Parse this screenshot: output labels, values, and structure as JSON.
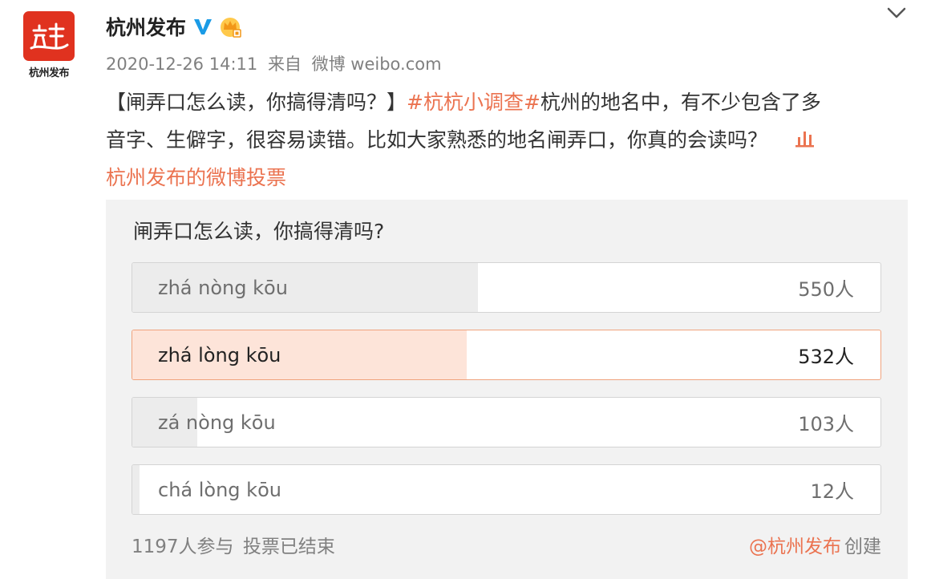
{
  "user": {
    "name": "杭州发布",
    "avatar_label": "杭州发布"
  },
  "meta": {
    "timestamp": "2020-12-26 14:11",
    "source_prefix": "来自",
    "source": "微博 weibo.com"
  },
  "post": {
    "line1_prefix": "【闸弄口怎么读，你搞得清吗？】",
    "hashtag": "#杭杭小调查#",
    "line1_suffix": "杭州的地名中，有不少包含了多",
    "line2": "音字、生僻字，很容易读错。比如大家熟悉的地名闸弄口，你真的会读吗？",
    "vote_link": "杭州发布的微博投票"
  },
  "poll": {
    "title": "闸弄口怎么读，你搞得清吗?",
    "options": [
      {
        "label": "zhá nòng kōu",
        "count": "550人",
        "votes": 550,
        "selected": false
      },
      {
        "label": "zhá lòng kōu",
        "count": "532人",
        "votes": 532,
        "selected": true
      },
      {
        "label": "zá nòng kōu",
        "count": "103人",
        "votes": 103,
        "selected": false
      },
      {
        "label": "chá lòng kōu",
        "count": "12人",
        "votes": 12,
        "selected": false
      }
    ],
    "participants": "1197人参与",
    "status": "投票已结束",
    "creator": "@杭州发布",
    "created_label": "创建"
  },
  "colors": {
    "brand_red": "#e0321f",
    "link_orange": "#eb7350",
    "verified_blue": "#1a9be6",
    "selected_fill": "#fde4d9",
    "selected_border": "#f0a37d"
  },
  "icons": {
    "avatar": "hangzhou-logo-icon",
    "verified": "verified-v-icon",
    "vip": "vip-crown-icon",
    "collapse": "chevron-down-icon",
    "vote": "poll-icon"
  }
}
